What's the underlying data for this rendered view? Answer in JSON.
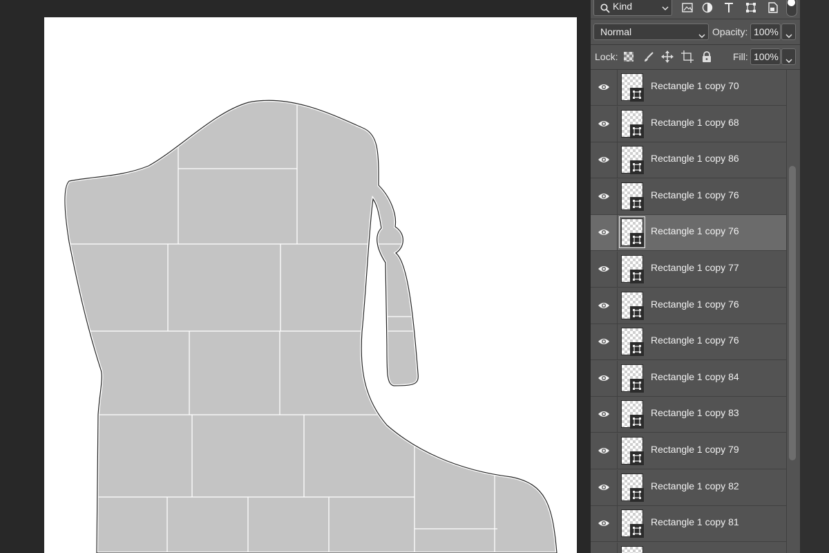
{
  "toolbar": {
    "filter_kind": "Kind",
    "filter_icons": [
      "image-filter-icon",
      "adjustment-filter-icon",
      "type-filter-icon",
      "shape-filter-icon",
      "smart-object-filter-icon"
    ],
    "blend_mode": "Normal",
    "opacity_label": "Opacity:",
    "opacity_value": "100%",
    "lock_label": "Lock:",
    "lock_icons": [
      "lock-transparent-pixels-icon",
      "lock-image-pixels-icon",
      "lock-position-icon",
      "lock-artboard-icon",
      "lock-all-icon"
    ],
    "fill_label": "Fill:",
    "fill_value": "100%"
  },
  "layers": [
    {
      "name": "Rectangle 1 copy 70",
      "selected": false
    },
    {
      "name": "Rectangle 1 copy 68",
      "selected": false
    },
    {
      "name": "Rectangle 1 copy 86",
      "selected": false
    },
    {
      "name": "Rectangle 1 copy 76",
      "selected": false
    },
    {
      "name": "Rectangle 1 copy 76",
      "selected": true
    },
    {
      "name": "Rectangle 1 copy 77",
      "selected": false
    },
    {
      "name": "Rectangle 1 copy 76",
      "selected": false
    },
    {
      "name": "Rectangle 1 copy 76",
      "selected": false
    },
    {
      "name": "Rectangle 1 copy 84",
      "selected": false
    },
    {
      "name": "Rectangle 1 copy 83",
      "selected": false
    },
    {
      "name": "Rectangle 1 copy 79",
      "selected": false
    },
    {
      "name": "Rectangle 1 copy 82",
      "selected": false
    },
    {
      "name": "Rectangle 1 copy 81",
      "selected": false
    },
    {
      "name": "",
      "selected": false
    }
  ],
  "colors": {
    "panel_bg": "#535353",
    "selected_row": "#6b6b6b",
    "canvas_bg": "#282828",
    "document_bg": "#ffffff",
    "shape_fill": "#c4c4c4"
  }
}
